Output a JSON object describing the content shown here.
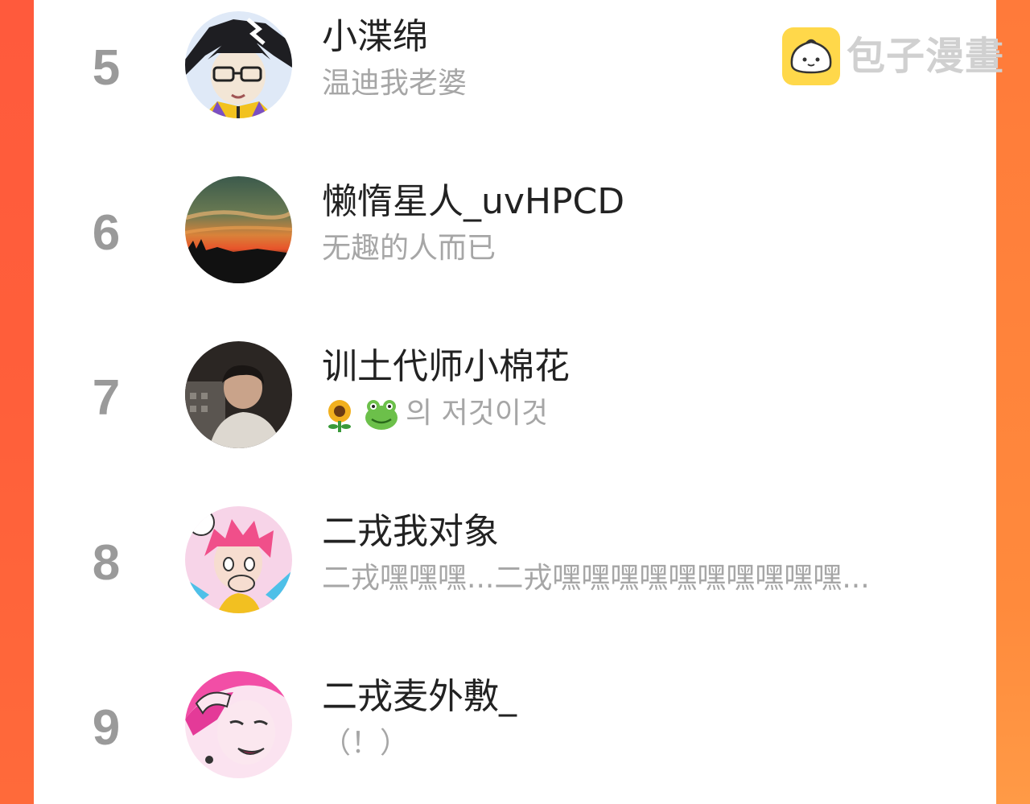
{
  "watermark": {
    "icon": "bun-logo-icon",
    "text": "包子漫畫",
    "mark_color": "#ffd84a"
  },
  "colors": {
    "background_left": "#ff5a3c",
    "background_right": "#ff8a3c",
    "panel": "#ffffff",
    "rank_text": "#9a9a9a",
    "name_text": "#222222",
    "subtitle_text": "#a6a6a6"
  },
  "entries": [
    {
      "rank": "5",
      "name": "小渫绵",
      "subtitle": "温迪我老婆",
      "avatar": "avatar-anime-boy-glasses"
    },
    {
      "rank": "6",
      "name": "懒惰星人_uvHPCD",
      "subtitle": "无趣的人而已",
      "avatar": "avatar-sunset-sky"
    },
    {
      "rank": "7",
      "name": "训土代师小棉花",
      "subtitle": "의 저것이것",
      "subtitle_icons": [
        "sunflower-emoji-icon",
        "frog-emoji-icon"
      ],
      "avatar": "avatar-photo-person"
    },
    {
      "rank": "8",
      "name": "二戎我对象",
      "subtitle": "二戎嘿嘿嘿...二戎嘿嘿嘿嘿嘿嘿嘿嘿嘿嘿...",
      "avatar": "avatar-anime-pink-hair"
    },
    {
      "rank": "9",
      "name": "二戎麦外敷_",
      "subtitle": "（！）",
      "avatar": "avatar-anime-pink-hair-laughing"
    }
  ]
}
